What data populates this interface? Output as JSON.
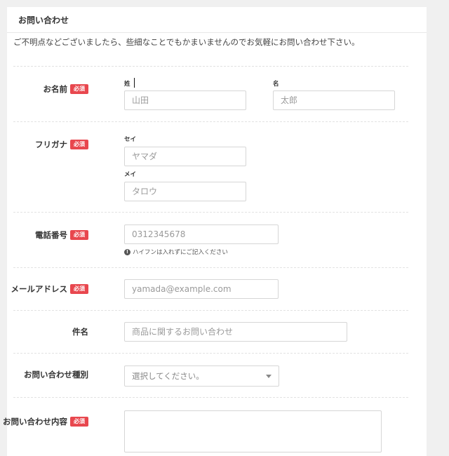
{
  "form": {
    "title": "お問い合わせ",
    "intro": "ご不明点などございましたら、些細なことでもかまいませんのでお気軽にお問い合わせ下さい。",
    "required_label": "必須"
  },
  "name": {
    "label": "お名前",
    "last_sub": "姓",
    "last_placeholder": "山田",
    "first_sub": "名",
    "first_placeholder": "太郎"
  },
  "furigana": {
    "label": "フリガナ",
    "sei_sub": "セイ",
    "sei_placeholder": "ヤマダ",
    "mei_sub": "メイ",
    "mei_placeholder": "タロウ"
  },
  "phone": {
    "label": "電話番号",
    "placeholder": "0312345678",
    "help": "ハイフンは入れずにご記入ください"
  },
  "email": {
    "label": "メールアドレス",
    "placeholder": "yamada@example.com"
  },
  "subject": {
    "label": "件名",
    "placeholder": "商品に関するお問い合わせ"
  },
  "inquiry_type": {
    "label": "お問い合わせ種別",
    "selected": "選択してください。"
  },
  "content": {
    "label": "お問い合わせ内容"
  }
}
